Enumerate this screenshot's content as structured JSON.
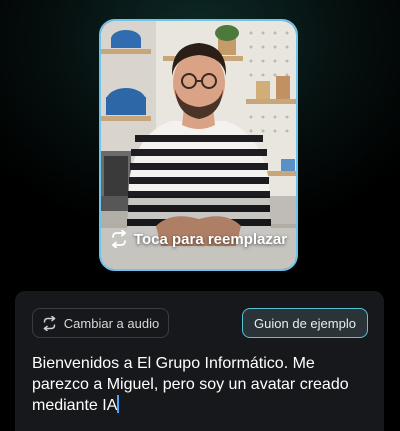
{
  "avatar_card": {
    "replace_label": "Toca para reemplazar"
  },
  "panel": {
    "audio_button_label": "Cambiar a audio",
    "sample_script_button_label": "Guion de ejemplo",
    "script_text": "Bienvenidos a El Grupo Informático. Me parezco a Miguel, pero soy un avatar creado mediante IA"
  },
  "colors": {
    "card_border": "#6ec3ea",
    "accent": "#55c2d6",
    "panel_bg": "#17181b",
    "caret": "#4aa8ff"
  },
  "icons": {
    "replace": "swap-arrows-icon",
    "audio": "swap-arrows-icon"
  }
}
